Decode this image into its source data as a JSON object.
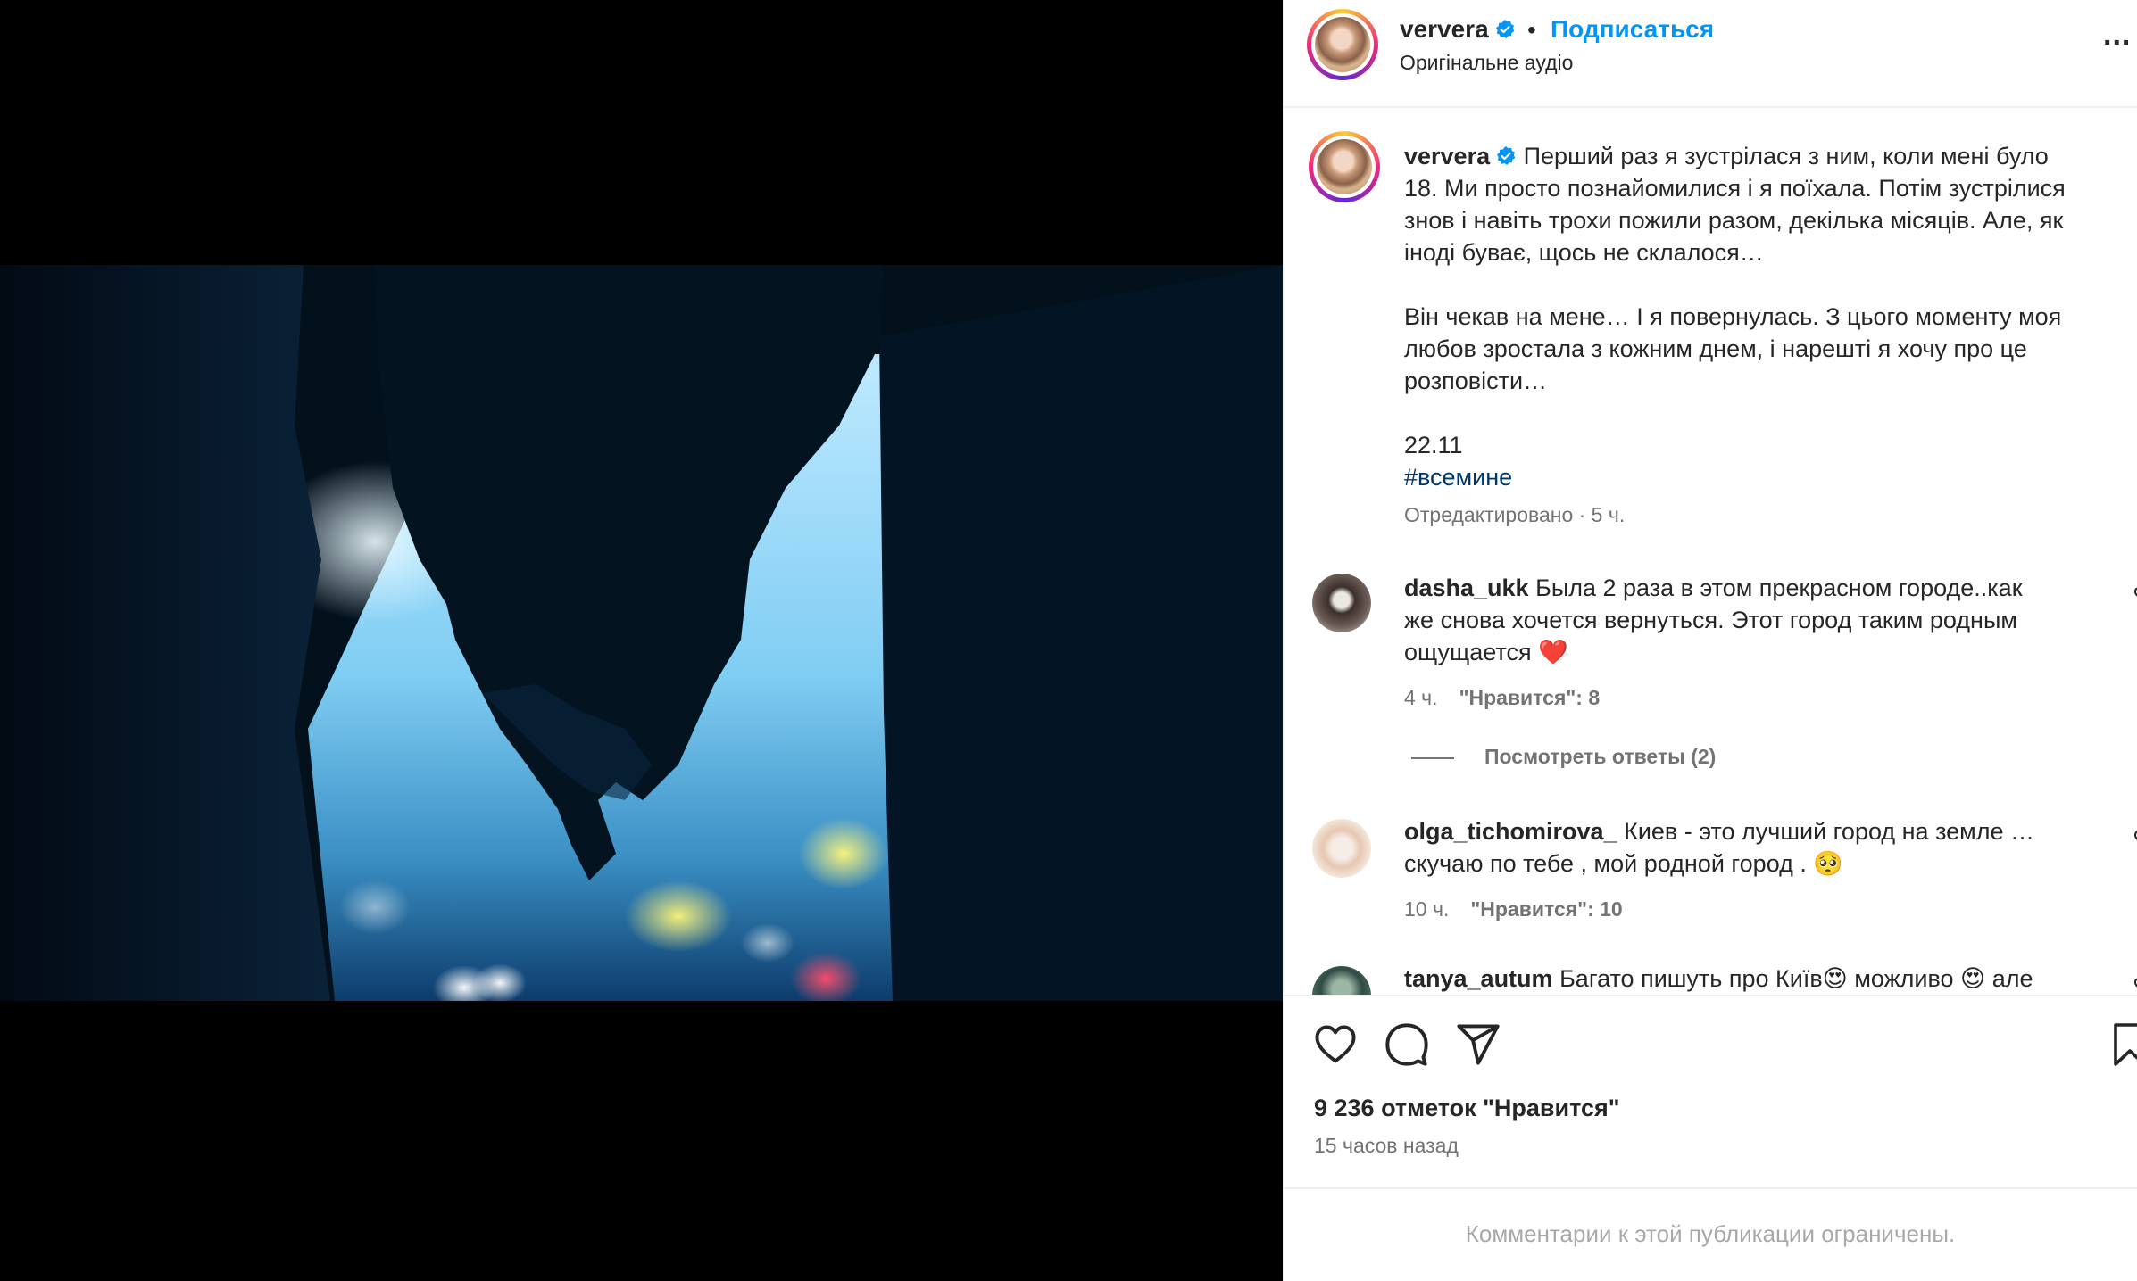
{
  "media": {
    "sound_icon": "volume-icon"
  },
  "header": {
    "username": "ververa",
    "separator": "•",
    "follow_label": "Подписаться",
    "audio_label": "Оригінальне аудіо",
    "more_icon": "more-icon",
    "more_label": "..."
  },
  "caption": {
    "username": "ververa",
    "line1": "Перший раз я зустрілася з ним, коли мені було",
    "line2": "18. Ми просто познайомилися і я поїхала. Потім зустрілися",
    "line3": "знов і навіть трохи пожили разом, декілька місяців. Але, як",
    "line4": "іноді буває, щось не склалося…",
    "line5": "Він чекав на мене… І я повернулась. З цього моменту моя",
    "line6": "любов зростала з кожним днем, і нарешті я хочу про це",
    "line7": "розповісти…",
    "date": "22.11",
    "hashtag": "#всемине",
    "meta": "Отредактировано · 5 ч."
  },
  "comments": [
    {
      "username": "dasha_ukk",
      "text_l1": "Была 2 раза в этом прекрасном городе..как",
      "text_l2": "же снова хочется вернуться. Этот город таким родным",
      "text_l3": "ощущается ❤️",
      "time": "4 ч.",
      "likes": "\"Нравится\": 8",
      "replies_label": "Посмотреть ответы (2)"
    },
    {
      "username": "olga_tichomirova_",
      "text_l1": "Киев - это лучший город на земле …",
      "text_l2": "скучаю по тебе , мой родной город . 🥺",
      "time": "10 ч.",
      "likes": "\"Нравится\": 10"
    },
    {
      "username": "tanya_autum",
      "text_l1": "Багато пишуть про Київ😍 можливо 😍 але"
    }
  ],
  "actions": {
    "like_icon": "heart-icon",
    "comment_icon": "comment-icon",
    "share_icon": "share-icon",
    "save_icon": "bookmark-icon",
    "likes_count": "9 236 отметок \"Нравится\"",
    "posted": "15 часов назад"
  },
  "footer": {
    "comments_limited": "Комментарии к этой публикации ограничены."
  },
  "colors": {
    "link_blue": "#0095f6",
    "hashtag": "#00376b",
    "muted": "#737373"
  }
}
